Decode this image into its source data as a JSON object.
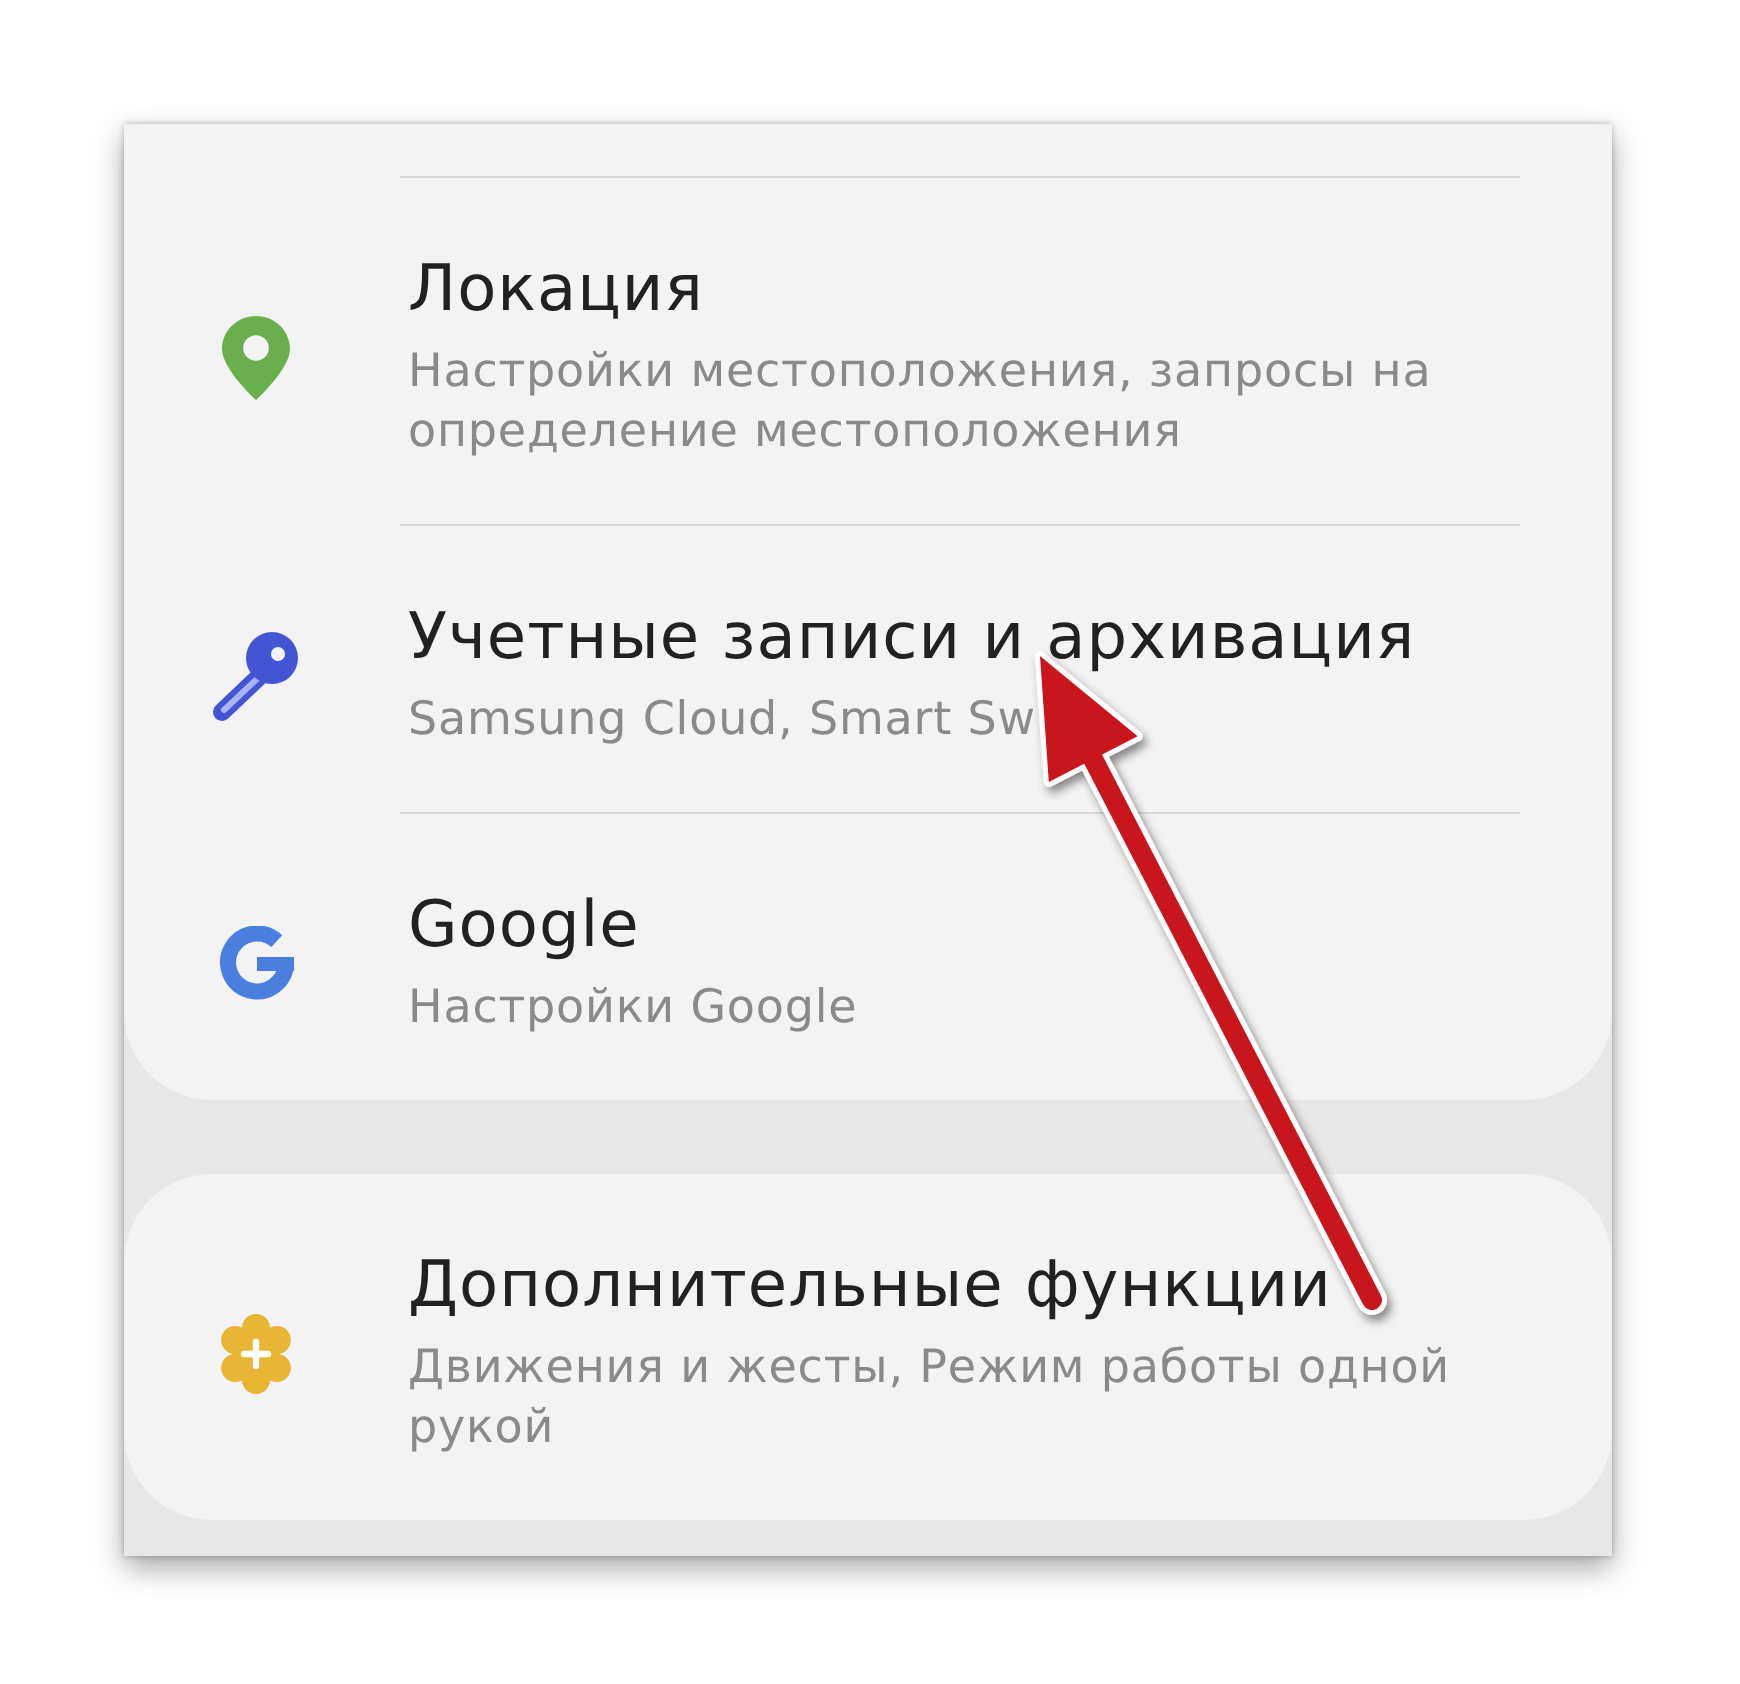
{
  "settings_list": {
    "groups": [
      {
        "continued": true,
        "items": [
          {
            "title": "Локация",
            "subtitle": "Настройки местоположения, запросы на определение местоположения"
          },
          {
            "title": "Учетные записи и архивация",
            "subtitle": "Samsung Cloud, Smart Sw"
          },
          {
            "title": "Google",
            "subtitle": "Настройки Google"
          }
        ]
      },
      {
        "continued": false,
        "items": [
          {
            "title": "Дополнительные функции",
            "subtitle": "Движения и жесты, Режим работы одной рукой"
          }
        ]
      }
    ]
  }
}
